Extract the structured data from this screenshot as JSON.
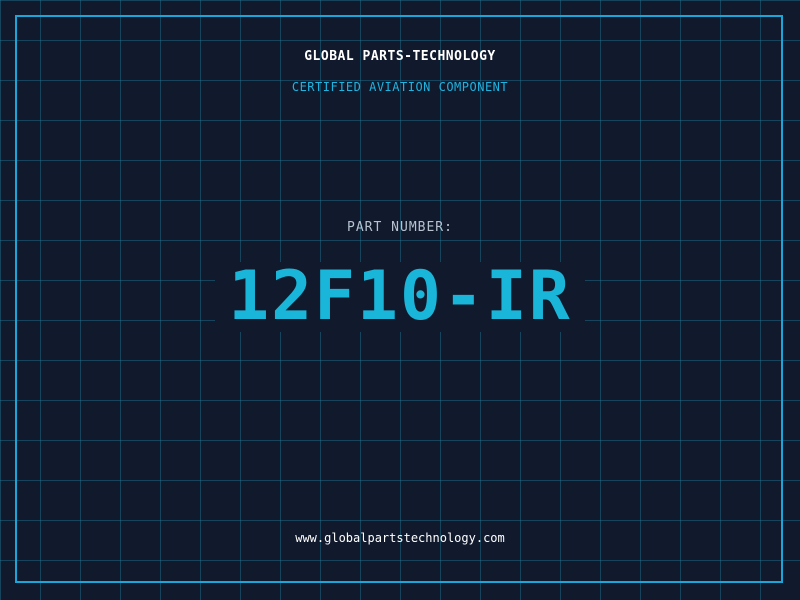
{
  "brand": {
    "name": "GLOBAL PARTS-TECHNOLOGY",
    "tagline": "CERTIFIED AVIATION COMPONENT"
  },
  "part": {
    "label": "PART NUMBER:",
    "number": "12F10-IR"
  },
  "footer": {
    "website": "www.globalpartstechnology.com"
  },
  "colors": {
    "background": "#111a2d",
    "grid": "#1e7896",
    "frame": "#1aa6d8",
    "accent": "#19b6da",
    "label": "#b7c2cf",
    "text": "#ffffff"
  }
}
